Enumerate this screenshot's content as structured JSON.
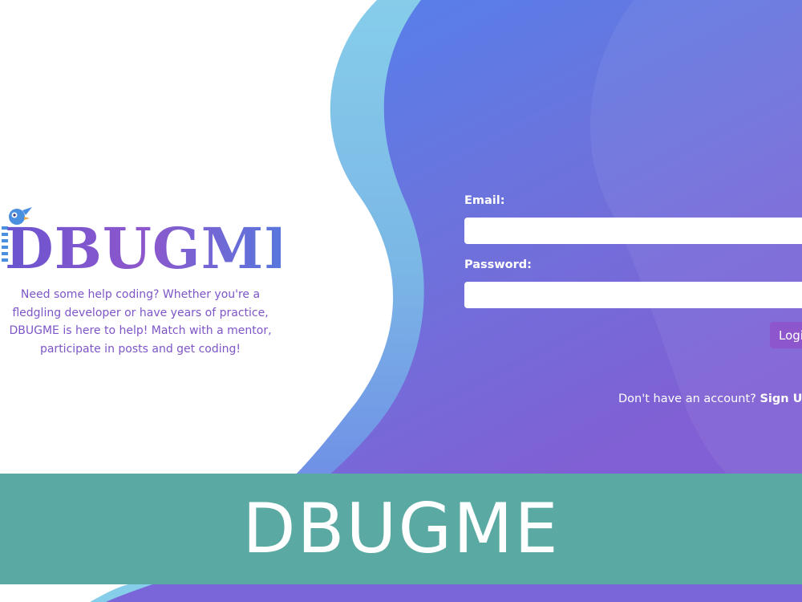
{
  "brand": {
    "logo_text": "DBUGME",
    "tagline": "Need some help coding? Whether you're a fledgling developer or have years of practice, DBUGME is here to help! Match with a mentor, participate in posts and get coding!"
  },
  "login": {
    "email_label": "Email:",
    "email_value": "",
    "password_label": "Password:",
    "password_value": "",
    "login_button": "Login",
    "signup_prompt": "Don't have an account?",
    "signup_link": "Sign Up"
  },
  "banner": {
    "title": "DBUGME"
  },
  "colors": {
    "accent_purple": "#8e56cc",
    "gradient_blue": "#5a7de8",
    "gradient_purple": "#7e64d6",
    "wave_light_blue": "#86cdea",
    "banner_teal": "#5aaaa3"
  }
}
